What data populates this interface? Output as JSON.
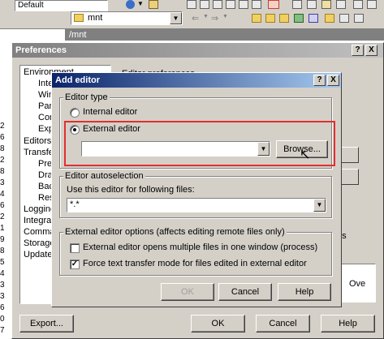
{
  "top_toolbar": {
    "drive_combo": "Default",
    "path_combo": "mnt",
    "address_path": "/mnt"
  },
  "preferences": {
    "title": "Preferences",
    "help_btn": "?",
    "close_btn": "X",
    "tree": [
      "Environment",
      "Inte",
      "Win",
      "Pan",
      "Com",
      "Exp",
      "Editors",
      "Transfer",
      "Pres",
      "Drag",
      "Bac",
      "Resu",
      "Logging",
      "Integratio",
      "Comman",
      "Storage",
      "Updates"
    ],
    "editor_prefs_label": "Editor preferences",
    "right_fragments": [
      "es",
      "Ove"
    ],
    "export_btn": "Export...",
    "ok_btn": "OK",
    "cancel_btn": "Cancel",
    "help_button": "Help"
  },
  "add_editor": {
    "title": "Add editor",
    "help_btn": "?",
    "close_btn": "X",
    "editor_type_group": "Editor type",
    "internal_editor": "Internal editor",
    "external_editor": "External editor",
    "external_value": "",
    "browse_btn": "Browse...",
    "autoselection_group": "Editor autoselection",
    "use_for_files_label": "Use this editor for following files:",
    "file_mask": "*.*",
    "external_options_group": "External editor options (affects editing remote files only)",
    "opt_multiple_files": "External editor opens multiple files in one window (process)",
    "opt_multiple_checked": false,
    "opt_force_text": "Force text transfer mode for files edited in external editor",
    "opt_force_checked": true,
    "ok_btn": "OK",
    "cancel_btn": "Cancel",
    "help_button": "Help"
  },
  "left_edge_numbers": [
    "2",
    "6",
    "8",
    "2",
    "8",
    "3",
    "4",
    "6",
    "2",
    "1",
    "9",
    "8",
    "5",
    "4",
    "3",
    "3",
    "6",
    "0",
    "7"
  ],
  "colors": {
    "titlebar_active_start": "#0a246a",
    "titlebar_active_end": "#a6caf0",
    "titlebar_inactive_start": "#808080",
    "titlebar_inactive_end": "#c0c0c0",
    "dialog_face": "#d4d0c8",
    "highlight_box": "#e03030"
  }
}
